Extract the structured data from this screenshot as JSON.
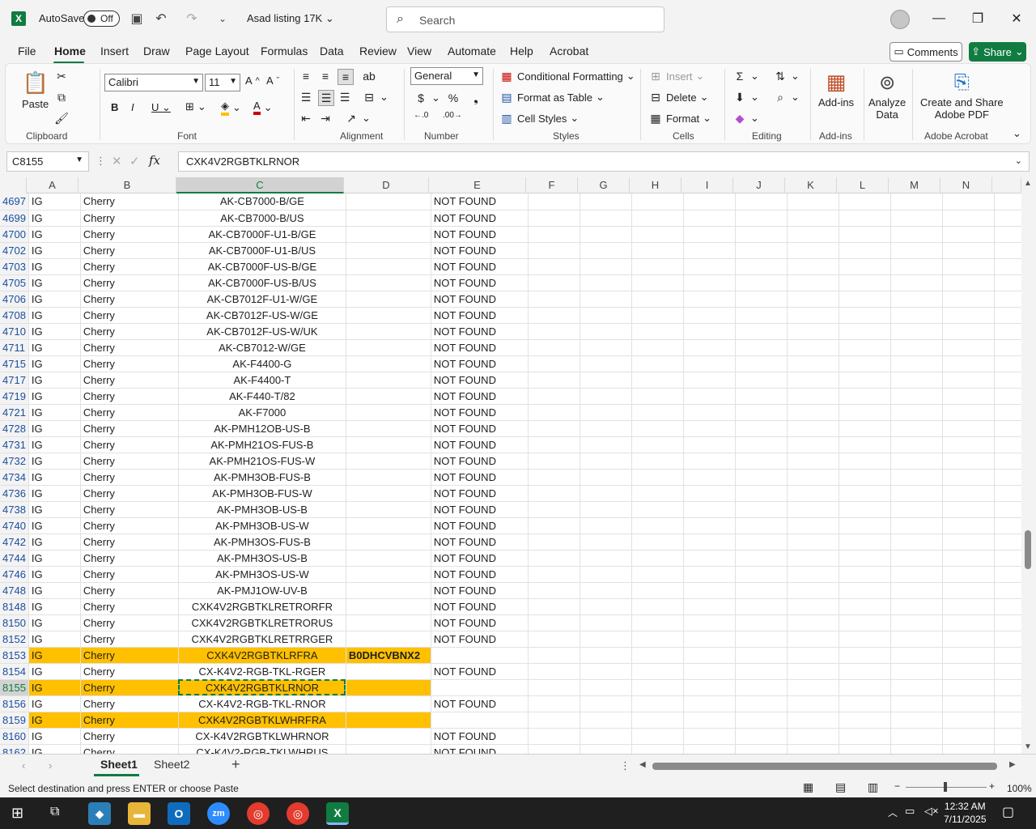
{
  "titlebar": {
    "autosave_label": "AutoSave",
    "autosave_state": "Off",
    "doc_title": "Asad listing 17K",
    "search_placeholder": "Search"
  },
  "menu": {
    "items": [
      "File",
      "Home",
      "Insert",
      "Draw",
      "Page Layout",
      "Formulas",
      "Data",
      "Review",
      "View",
      "Automate",
      "Help",
      "Acrobat"
    ],
    "active": "Home",
    "comments": "Comments",
    "share": "Share"
  },
  "ribbon": {
    "clipboard": {
      "label": "Clipboard",
      "paste": "Paste"
    },
    "font": {
      "label": "Font",
      "name": "Calibri",
      "size": "11"
    },
    "alignment": {
      "label": "Alignment"
    },
    "number": {
      "label": "Number",
      "format": "General"
    },
    "styles": {
      "label": "Styles",
      "conditional": "Conditional Formatting",
      "format_table": "Format as Table",
      "cell_styles": "Cell Styles"
    },
    "cells": {
      "label": "Cells",
      "insert": "Insert",
      "delete": "Delete",
      "format": "Format"
    },
    "editing": {
      "label": "Editing"
    },
    "addins": {
      "label": "Add-ins",
      "button": "Add-ins"
    },
    "analyze": {
      "line1": "Analyze",
      "line2": "Data"
    },
    "acrobat": {
      "label": "Adobe Acrobat",
      "line1": "Create and Share",
      "line2": "Adobe PDF"
    }
  },
  "formula": {
    "namebox": "C8155",
    "value": "CXK4V2RGBTKLRNOR"
  },
  "columns": [
    "A",
    "B",
    "C",
    "D",
    "E",
    "F",
    "G",
    "H",
    "I",
    "J",
    "K",
    "L",
    "M",
    "N"
  ],
  "rows": [
    {
      "n": "4697",
      "a": "IG",
      "b": "Cherry",
      "c": "AK-CB7000-B/GE",
      "d": "",
      "e": "NOT FOUND",
      "hl": false
    },
    {
      "n": "4699",
      "a": "IG",
      "b": "Cherry",
      "c": "AK-CB7000-B/US",
      "d": "",
      "e": "NOT FOUND",
      "hl": false
    },
    {
      "n": "4700",
      "a": "IG",
      "b": "Cherry",
      "c": "AK-CB7000F-U1-B/GE",
      "d": "",
      "e": "NOT FOUND",
      "hl": false
    },
    {
      "n": "4702",
      "a": "IG",
      "b": "Cherry",
      "c": "AK-CB7000F-U1-B/US",
      "d": "",
      "e": "NOT FOUND",
      "hl": false
    },
    {
      "n": "4703",
      "a": "IG",
      "b": "Cherry",
      "c": "AK-CB7000F-US-B/GE",
      "d": "",
      "e": "NOT FOUND",
      "hl": false
    },
    {
      "n": "4705",
      "a": "IG",
      "b": "Cherry",
      "c": "AK-CB7000F-US-B/US",
      "d": "",
      "e": "NOT FOUND",
      "hl": false
    },
    {
      "n": "4706",
      "a": "IG",
      "b": "Cherry",
      "c": "AK-CB7012F-U1-W/GE",
      "d": "",
      "e": "NOT FOUND",
      "hl": false
    },
    {
      "n": "4708",
      "a": "IG",
      "b": "Cherry",
      "c": "AK-CB7012F-US-W/GE",
      "d": "",
      "e": "NOT FOUND",
      "hl": false
    },
    {
      "n": "4710",
      "a": "IG",
      "b": "Cherry",
      "c": "AK-CB7012F-US-W/UK",
      "d": "",
      "e": "NOT FOUND",
      "hl": false
    },
    {
      "n": "4711",
      "a": "IG",
      "b": "Cherry",
      "c": "AK-CB7012-W/GE",
      "d": "",
      "e": "NOT FOUND",
      "hl": false
    },
    {
      "n": "4715",
      "a": "IG",
      "b": "Cherry",
      "c": "AK-F4400-G",
      "d": "",
      "e": "NOT FOUND",
      "hl": false
    },
    {
      "n": "4717",
      "a": "IG",
      "b": "Cherry",
      "c": "AK-F4400-T",
      "d": "",
      "e": "NOT FOUND",
      "hl": false
    },
    {
      "n": "4719",
      "a": "IG",
      "b": "Cherry",
      "c": "AK-F440-T/82",
      "d": "",
      "e": "NOT FOUND",
      "hl": false
    },
    {
      "n": "4721",
      "a": "IG",
      "b": "Cherry",
      "c": "AK-F7000",
      "d": "",
      "e": "NOT FOUND",
      "hl": false
    },
    {
      "n": "4728",
      "a": "IG",
      "b": "Cherry",
      "c": "AK-PMH12OB-US-B",
      "d": "",
      "e": "NOT FOUND",
      "hl": false
    },
    {
      "n": "4731",
      "a": "IG",
      "b": "Cherry",
      "c": "AK-PMH21OS-FUS-B",
      "d": "",
      "e": "NOT FOUND",
      "hl": false
    },
    {
      "n": "4732",
      "a": "IG",
      "b": "Cherry",
      "c": "AK-PMH21OS-FUS-W",
      "d": "",
      "e": "NOT FOUND",
      "hl": false
    },
    {
      "n": "4734",
      "a": "IG",
      "b": "Cherry",
      "c": "AK-PMH3OB-FUS-B",
      "d": "",
      "e": "NOT FOUND",
      "hl": false
    },
    {
      "n": "4736",
      "a": "IG",
      "b": "Cherry",
      "c": "AK-PMH3OB-FUS-W",
      "d": "",
      "e": "NOT FOUND",
      "hl": false
    },
    {
      "n": "4738",
      "a": "IG",
      "b": "Cherry",
      "c": "AK-PMH3OB-US-B",
      "d": "",
      "e": "NOT FOUND",
      "hl": false
    },
    {
      "n": "4740",
      "a": "IG",
      "b": "Cherry",
      "c": "AK-PMH3OB-US-W",
      "d": "",
      "e": "NOT FOUND",
      "hl": false
    },
    {
      "n": "4742",
      "a": "IG",
      "b": "Cherry",
      "c": "AK-PMH3OS-FUS-B",
      "d": "",
      "e": "NOT FOUND",
      "hl": false
    },
    {
      "n": "4744",
      "a": "IG",
      "b": "Cherry",
      "c": "AK-PMH3OS-US-B",
      "d": "",
      "e": "NOT FOUND",
      "hl": false
    },
    {
      "n": "4746",
      "a": "IG",
      "b": "Cherry",
      "c": "AK-PMH3OS-US-W",
      "d": "",
      "e": "NOT FOUND",
      "hl": false
    },
    {
      "n": "4748",
      "a": "IG",
      "b": "Cherry",
      "c": "AK-PMJ1OW-UV-B",
      "d": "",
      "e": "NOT FOUND",
      "hl": false
    },
    {
      "n": "8148",
      "a": "IG",
      "b": "Cherry",
      "c": "CXK4V2RGBTKLRETRORFR",
      "d": "",
      "e": "NOT FOUND",
      "hl": false
    },
    {
      "n": "8150",
      "a": "IG",
      "b": "Cherry",
      "c": "CXK4V2RGBTKLRETRORUS",
      "d": "",
      "e": "NOT FOUND",
      "hl": false
    },
    {
      "n": "8152",
      "a": "IG",
      "b": "Cherry",
      "c": "CXK4V2RGBTKLRETRRGER",
      "d": "",
      "e": "NOT FOUND",
      "hl": false
    },
    {
      "n": "8153",
      "a": "IG",
      "b": "Cherry",
      "c": "CXK4V2RGBTKLRFRA",
      "d": "B0DHCVBNX2",
      "e": "",
      "hl": true
    },
    {
      "n": "8154",
      "a": "IG",
      "b": "Cherry",
      "c": "CX-K4V2-RGB-TKL-RGER",
      "d": "",
      "e": "NOT FOUND",
      "hl": false
    },
    {
      "n": "8155",
      "a": "IG",
      "b": "Cherry",
      "c": "CXK4V2RGBTKLRNOR",
      "d": "",
      "e": "",
      "hl": true
    },
    {
      "n": "8156",
      "a": "IG",
      "b": "Cherry",
      "c": "CX-K4V2-RGB-TKL-RNOR",
      "d": "",
      "e": "NOT FOUND",
      "hl": false
    },
    {
      "n": "8159",
      "a": "IG",
      "b": "Cherry",
      "c": "CXK4V2RGBTKLWHRFRA",
      "d": "",
      "e": "",
      "hl": true
    },
    {
      "n": "8160",
      "a": "IG",
      "b": "Cherry",
      "c": "CX-K4V2RGBTKLWHRNOR",
      "d": "",
      "e": "NOT FOUND",
      "hl": false
    },
    {
      "n": "8162",
      "a": "IG",
      "b": "Cherry",
      "c": "CX-K4V2-RGB-TKLWHRUS",
      "d": "",
      "e": "NOT FOUND",
      "hl": false
    }
  ],
  "active_row": "8155",
  "sheets": {
    "tabs": [
      "Sheet1",
      "Sheet2"
    ],
    "active": "Sheet1"
  },
  "status": {
    "text": "Select destination and press ENTER or choose Paste",
    "zoom": "100%"
  },
  "taskbar": {
    "time": "12:32 AM",
    "date": "7/11/2025"
  },
  "colors": {
    "accent": "#107c41",
    "highlight": "#ffc000"
  }
}
